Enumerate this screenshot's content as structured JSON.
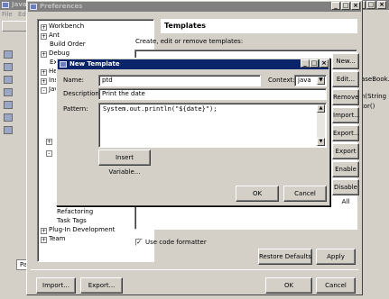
{
  "eclipse": {
    "title": "Java",
    "menu": [
      "File",
      "Ed"
    ],
    "right_snippets": [
      "aseBook.",
      "n(String",
      "tor()"
    ],
    "panel_tab": "Pa"
  },
  "preferences": {
    "title": "Preferences",
    "page_heading": "Templates",
    "page_description": "Create, edit or remove templates:",
    "tree": [
      {
        "label": "Workbench",
        "expander": "+"
      },
      {
        "label": "Ant",
        "expander": "+"
      },
      {
        "label": "Build Order",
        "expander": ""
      },
      {
        "label": "Debug",
        "expander": "+"
      },
      {
        "label": "Exte",
        "expander": ""
      },
      {
        "label": "Help",
        "expander": "+"
      },
      {
        "label": "Insta",
        "expander": "+"
      },
      {
        "label": "Java",
        "expander": "-"
      },
      {
        "label": "Refactoring",
        "expander": ""
      },
      {
        "label": "Task Tags",
        "expander": ""
      },
      {
        "label": "Plug-In Development",
        "expander": "+"
      },
      {
        "label": "Team",
        "expander": "+"
      }
    ],
    "side_buttons": [
      "New...",
      "Edit...",
      "Remove",
      "Import...",
      "Export...",
      "Export All...",
      "Enable All",
      "Disable All"
    ],
    "use_code_formatter_label": "Use code formatter",
    "use_code_formatter_checked": true,
    "restore_defaults_label": "Restore Defaults",
    "apply_label": "Apply",
    "import_label": "Import...",
    "export_label": "Export...",
    "ok_label": "OK",
    "cancel_label": "Cancel"
  },
  "new_template": {
    "title": "New Template",
    "name_label": "Name:",
    "name_value": "ptd",
    "context_label": "Context:",
    "context_value": "java",
    "description_label": "Description:",
    "description_value": "Print the date",
    "pattern_label": "Pattern:",
    "pattern_value": "System.out.println(\"${date}\");",
    "insert_variable_label": "Insert Variable...",
    "ok_label": "OK",
    "cancel_label": "Cancel"
  }
}
